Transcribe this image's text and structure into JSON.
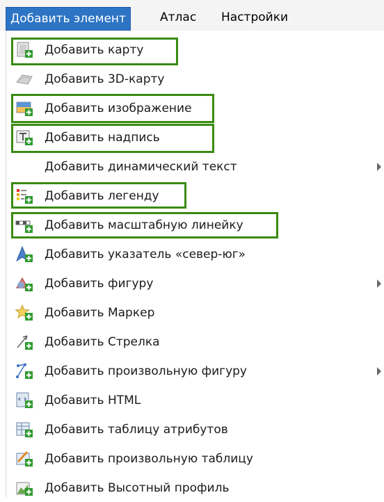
{
  "menubar": {
    "items": [
      "Добавить элемент",
      "Атлас",
      "Настройки"
    ]
  },
  "menu": {
    "items": [
      {
        "label": "Добавить карту",
        "icon": "map-icon",
        "highlight": true
      },
      {
        "label": "Добавить 3D-карту",
        "icon": "3d-map-icon",
        "highlight": false
      },
      {
        "label": "Добавить изображение",
        "icon": "image-icon",
        "highlight": true
      },
      {
        "label": "Добавить надпись",
        "icon": "label-icon",
        "highlight": true
      },
      {
        "label": "Добавить динамический текст",
        "icon": "",
        "submenu": true,
        "highlight": false
      },
      {
        "label": "Добавить легенду",
        "icon": "legend-icon",
        "highlight": true
      },
      {
        "label": "Добавить масштабную линейку",
        "icon": "scalebar-icon",
        "highlight": true
      },
      {
        "label": "Добавить указатель «север-юг»",
        "icon": "north-arrow-icon",
        "highlight": false
      },
      {
        "label": "Добавить фигуру",
        "icon": "shape-icon",
        "submenu": true,
        "highlight": false
      },
      {
        "label": "Добавить Маркер",
        "icon": "marker-icon",
        "highlight": false
      },
      {
        "label": "Добавить Стрелка",
        "icon": "arrow-icon",
        "highlight": false
      },
      {
        "label": "Добавить произвольную фигуру",
        "icon": "polygon-icon",
        "submenu": true,
        "highlight": false
      },
      {
        "label": "Добавить HTML",
        "icon": "html-icon",
        "highlight": false
      },
      {
        "label": "Добавить таблицу атрибутов",
        "icon": "attribute-table-icon",
        "highlight": false
      },
      {
        "label": "Добавить произвольную таблицу",
        "icon": "fixed-table-icon",
        "highlight": false
      },
      {
        "label": "Добавить Высотный профиль",
        "icon": "elevation-profile-icon",
        "highlight": false
      }
    ]
  },
  "colors": {
    "highlight_border": "#3a8a12",
    "menubar_active": "#2d74c4",
    "add_badge": "#2f9a2f"
  }
}
